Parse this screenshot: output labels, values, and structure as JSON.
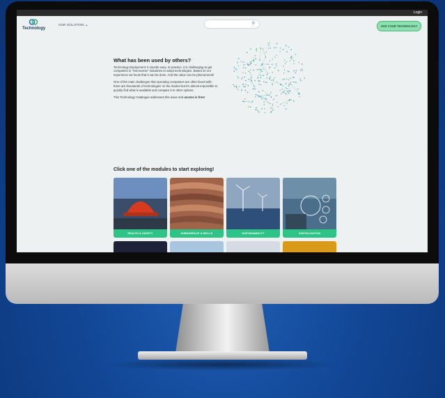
{
  "topbar": {
    "login_label": "Login"
  },
  "nav": {
    "logo_text": "Technology",
    "solution_label": "OUR SOLUTION",
    "search_placeholder": "",
    "add_button_label": "ADD YOUR TECHNOLOGY"
  },
  "intro": {
    "heading": "What has been used by others?",
    "paragraph1": "Technology Deployment: it sounds easy. In practice, it is challenging to get companies in \"risk-averse\" industries to adopt technologies. Based on our experience we know that it can be done. And the value can be phenomenal!",
    "paragraph2": "One of the main challenges that operating companies are often faced with: there are thousands of technologies on the market but it's almost impossible to quickly find what is available and compare it to other options.",
    "paragraph3_prefix": "This Technology Catalogue addresses this issue and ",
    "paragraph3_bold": "access is free!"
  },
  "modules": {
    "title": "Click one of the modules to start exploring!",
    "items": [
      {
        "label": "HEALTH & SAFETY"
      },
      {
        "label": "SUBSURFACE & WELLS"
      },
      {
        "label": "SUSTAINABILITY"
      },
      {
        "label": "DIGITALIZATION"
      }
    ]
  },
  "colors": {
    "accent_green": "#2ec487",
    "button_green": "#8fe0b0",
    "background": "#1f5fb5"
  }
}
